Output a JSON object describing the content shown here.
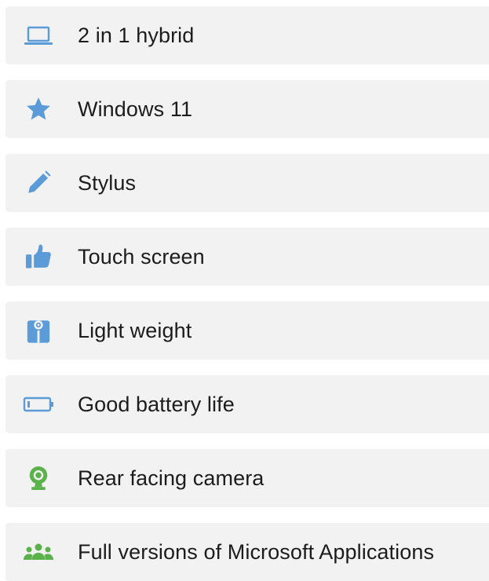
{
  "colors": {
    "icon_blue": "#5a9bd8",
    "icon_green": "#5bb14a",
    "row_bg": "#f2f2f2",
    "text": "#1c1c1c"
  },
  "features": [
    {
      "label": "2 in 1 hybrid",
      "icon": "laptop-icon"
    },
    {
      "label": "Windows 11",
      "icon": "star-icon"
    },
    {
      "label": "Stylus",
      "icon": "pencil-icon"
    },
    {
      "label": "Touch screen",
      "icon": "thumbs-up-icon"
    },
    {
      "label": "Light weight",
      "icon": "weight-icon"
    },
    {
      "label": "Good battery life",
      "icon": "battery-icon"
    },
    {
      "label": "Rear facing camera",
      "icon": "webcam-icon"
    },
    {
      "label": "Full versions of Microsoft Applications",
      "icon": "people-icon"
    }
  ]
}
